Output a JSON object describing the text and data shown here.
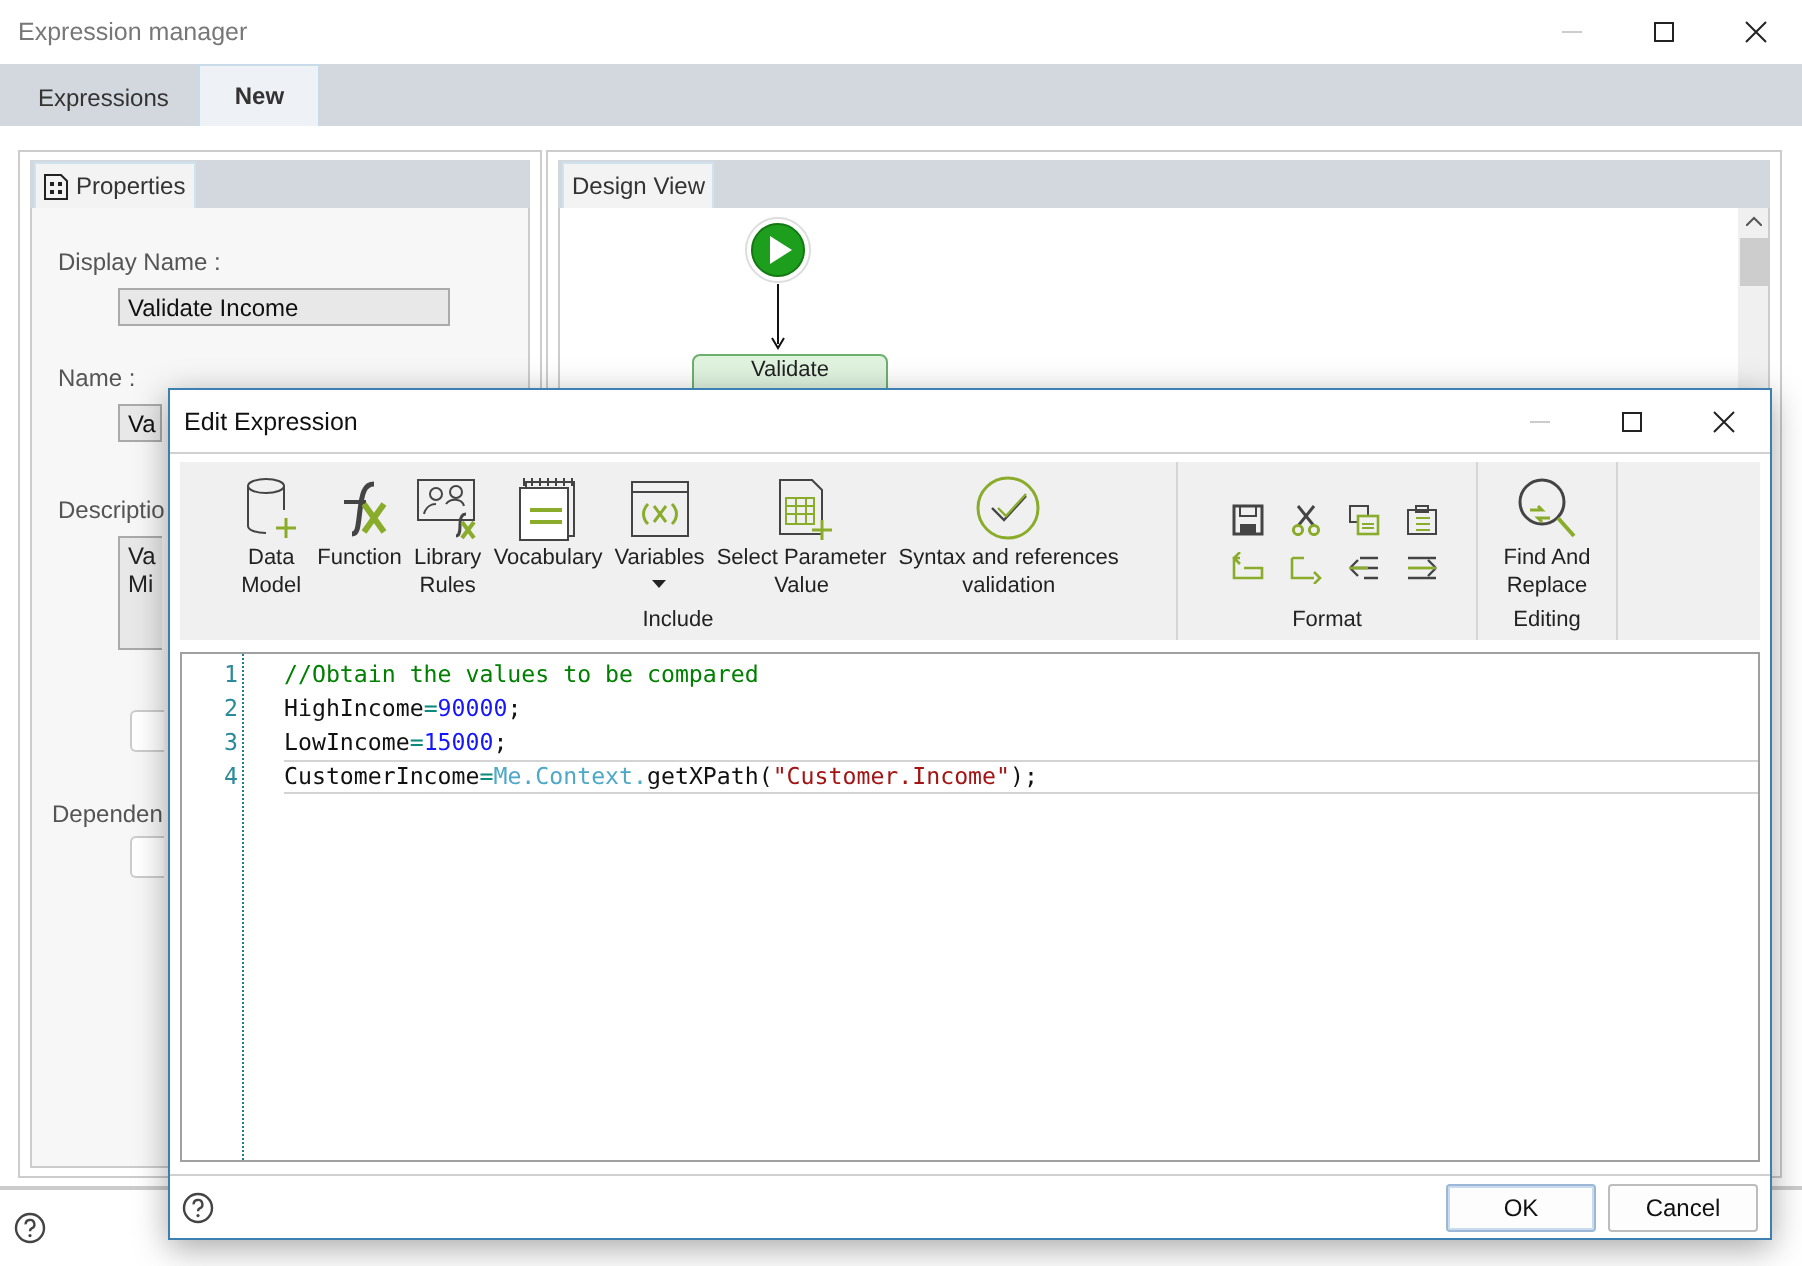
{
  "window": {
    "title": "Expression manager"
  },
  "tabs": [
    {
      "label": "Expressions",
      "selected": false
    },
    {
      "label": "New",
      "selected": true
    }
  ],
  "properties_panel": {
    "tab": "Properties",
    "fields": [
      {
        "label": "Display Name :",
        "value": "Validate Income"
      },
      {
        "label": "Name :",
        "value": "Va"
      }
    ],
    "description": {
      "label": "Descriptio",
      "lines": [
        "Va",
        "Mi"
      ]
    },
    "dependencies": {
      "label": "Dependen"
    }
  },
  "design_view": {
    "tab": "Design View",
    "node": "Validate"
  },
  "dialog": {
    "title": "Edit Expression",
    "ribbon": [
      {
        "label": "Include",
        "kind": "large",
        "buttons": [
          {
            "kind": "database",
            "label": "Data\nModel",
            "dropdown": false
          },
          {
            "kind": "function",
            "label": "Function",
            "dropdown": false
          },
          {
            "kind": "library",
            "label": "Library\nRules",
            "dropdown": false
          },
          {
            "kind": "vocabulary",
            "label": "Vocabulary",
            "dropdown": false
          },
          {
            "kind": "variables",
            "label": "Variables",
            "dropdown": true
          },
          {
            "kind": "parameter",
            "label": "Select Parameter\nValue",
            "dropdown": false
          },
          {
            "kind": "syntax",
            "label": "Syntax and references\nvalidation",
            "dropdown": false
          }
        ]
      },
      {
        "label": "Format",
        "kind": "small",
        "buttons": [
          {
            "kind": "save"
          },
          {
            "kind": "cut"
          },
          {
            "kind": "copy"
          },
          {
            "kind": "paste"
          },
          {
            "kind": "undo"
          },
          {
            "kind": "redo"
          },
          {
            "kind": "outdent"
          },
          {
            "kind": "indent"
          }
        ]
      },
      {
        "label": "Editing",
        "kind": "large",
        "buttons": [
          {
            "kind": "find",
            "label": "Find And\nReplace",
            "dropdown": false
          }
        ]
      }
    ],
    "editor": {
      "lines": [
        {
          "number": "1",
          "current": false,
          "tokens": [
            {
              "kind": "comment",
              "text": "//Obtain the values to be compared"
            }
          ]
        },
        {
          "number": "2",
          "current": false,
          "tokens": [
            {
              "kind": "ident",
              "text": "HighIncome"
            },
            {
              "kind": "op",
              "text": "="
            },
            {
              "kind": "number",
              "text": "90000"
            },
            {
              "kind": "ident",
              "text": ";"
            }
          ]
        },
        {
          "number": "3",
          "current": false,
          "tokens": [
            {
              "kind": "ident",
              "text": "LowIncome"
            },
            {
              "kind": "op",
              "text": "="
            },
            {
              "kind": "number",
              "text": "15000"
            },
            {
              "kind": "ident",
              "text": ";"
            }
          ]
        },
        {
          "number": "4",
          "current": true,
          "tokens": [
            {
              "kind": "ident",
              "text": "CustomerIncome"
            },
            {
              "kind": "op",
              "text": "="
            },
            {
              "kind": "member",
              "text": "Me.Context."
            },
            {
              "kind": "ident",
              "text": "getXPath("
            },
            {
              "kind": "string",
              "text": "\"Customer.Income\""
            },
            {
              "kind": "ident",
              "text": ");"
            }
          ]
        }
      ]
    },
    "buttons": [
      {
        "label": "OK",
        "default": true
      },
      {
        "label": "Cancel",
        "default": false
      }
    ]
  }
}
